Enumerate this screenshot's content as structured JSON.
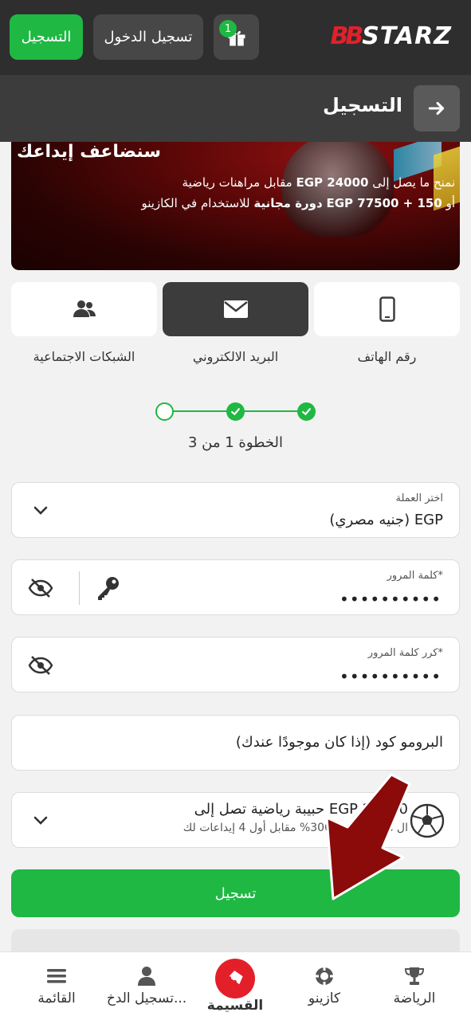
{
  "header": {
    "register_label": "التسجيل",
    "login_label": "تسجيل الدخول",
    "gift_badge": "1",
    "logo_mark": "BB",
    "logo_text": "STARZ"
  },
  "titlebar": {
    "title": "التسجيل"
  },
  "banner": {
    "headline": "سنضاعف إيداعك",
    "line1_pre": "نمنح ما يصل إلى",
    "line1_amount": "EGP 24000",
    "line1_post": "مقابل مراهنات رياضية",
    "line2_pre": "أو",
    "line2_amount": "EGP 77500 + 150",
    "line2_spins": "دورة مجانية",
    "line2_post": "للاستخدام في الكازينو"
  },
  "methods": {
    "social_label": "الشبكات الاجتماعية",
    "email_label": "البريد الالكتروني",
    "phone_label": "رقم الهاتف",
    "active": "email"
  },
  "stepper": {
    "text": "الخطوة 1 من 3",
    "current": 1,
    "total": 3
  },
  "form": {
    "currency_label": "اختر العملة",
    "currency_value": "EGP (جنيه مصري)",
    "password_label": "كلمة المرور*",
    "password_value": "••••••••••",
    "confirm_label": "كرر كلمة المرور*",
    "confirm_value": "••••••••••",
    "promo_placeholder": "البرومو كود (إذا كان موجودًا عندك)",
    "bonus_title": "حبيبة رياضية تصل إلى EGP 24000",
    "bonus_sub": "ال مكافأة بقيمة 300% مقابل أول 4 إيداعات لك",
    "submit_label": "تسجيل"
  },
  "bottom_nav": {
    "menu_label": "القائمة",
    "login_label": "تسجيل الدخ...",
    "coupon_label": "القسيمة",
    "casino_label": "كازينو",
    "sports_label": "الرياضة"
  },
  "colors": {
    "accent": "#1fb843",
    "brand_red": "#e3202a",
    "header_bg": "#2e2e2e",
    "arrow": "#8b0a0a"
  }
}
